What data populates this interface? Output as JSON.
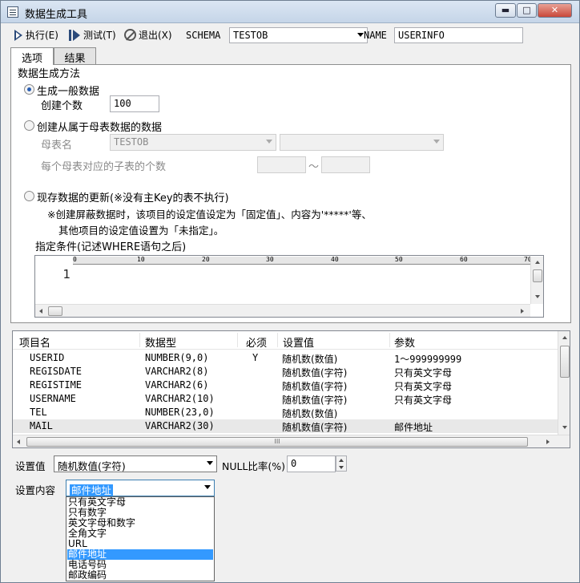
{
  "window": {
    "title": "数据生成工具",
    "controls": {
      "minimize": "▬",
      "maximize": "□",
      "close": "✕"
    }
  },
  "toolbar": {
    "execute_label": "执行(E)",
    "test_label": "测试(T)",
    "exit_label": "退出(X)",
    "schema_label": "SCHEMA",
    "schema_value": "TESTOB",
    "name_label": "NAME",
    "name_value": "USERINFO"
  },
  "tabs": [
    {
      "label": "选项",
      "active": true
    },
    {
      "label": "结果",
      "active": false
    }
  ],
  "options": {
    "group_title": "数据生成方法",
    "general": {
      "label": "生成一般数据",
      "checked": true,
      "count_label": "创建个数",
      "count_value": "100"
    },
    "child": {
      "label": "创建从属于母表数据的数据",
      "checked": false,
      "parent_label": "母表名",
      "parent_value": "TESTOB",
      "per_parent_label": "每个母表对应的子表的个数",
      "range_sep": "～"
    },
    "update": {
      "label": "现存数据的更新(※没有主Key的表不执行)",
      "checked": false,
      "note1": "※创建屏蔽数据时，该项目的设定值设定为「固定值」、内容为'*****'等、",
      "note2": "其他项目的设定值设置为「未指定」。",
      "condition_label": "指定条件(记述WHERE语句之后)",
      "ruler_marks": [
        "0",
        "10",
        "20",
        "30",
        "40",
        "50",
        "60",
        "70"
      ],
      "line_number": "1"
    }
  },
  "grid": {
    "columns": [
      "项目名",
      "数据型",
      "必须",
      "设置值",
      "参数"
    ],
    "rows": [
      {
        "name": "USERID",
        "type": "NUMBER(9,0)",
        "required": "Y",
        "setting": "随机数(数值)",
        "param": "1～999999999",
        "selected": false
      },
      {
        "name": "REGISDATE",
        "type": "VARCHAR2(8)",
        "required": "",
        "setting": "随机数值(字符)",
        "param": "只有英文字母",
        "selected": false
      },
      {
        "name": "REGISTIME",
        "type": "VARCHAR2(6)",
        "required": "",
        "setting": "随机数值(字符)",
        "param": "只有英文字母",
        "selected": false
      },
      {
        "name": "USERNAME",
        "type": "VARCHAR2(10)",
        "required": "",
        "setting": "随机数值(字符)",
        "param": "只有英文字母",
        "selected": false
      },
      {
        "name": "TEL",
        "type": "NUMBER(23,0)",
        "required": "",
        "setting": "随机数(数值)",
        "param": "",
        "selected": false
      },
      {
        "name": "MAIL",
        "type": "VARCHAR2(30)",
        "required": "",
        "setting": "随机数值(字符)",
        "param": "邮件地址",
        "selected": true
      }
    ],
    "hscroll_grip": "III"
  },
  "bottom": {
    "setting_label": "设置值",
    "setting_value": "随机数值(字符)",
    "null_ratio_label": "NULL比率(%)",
    "null_ratio_value": "0",
    "content_label": "设置内容",
    "content_value": "邮件地址",
    "content_options": [
      "只有英文字母",
      "只有数字",
      "英文字母和数字",
      "全角文字",
      "URL",
      "邮件地址",
      "电话号码",
      "邮政编码"
    ],
    "content_selected_index": 5
  },
  "colors": {
    "selection": "#3399ff",
    "radio_dot": "#2a5fb3",
    "close_button": "#c9483a"
  }
}
